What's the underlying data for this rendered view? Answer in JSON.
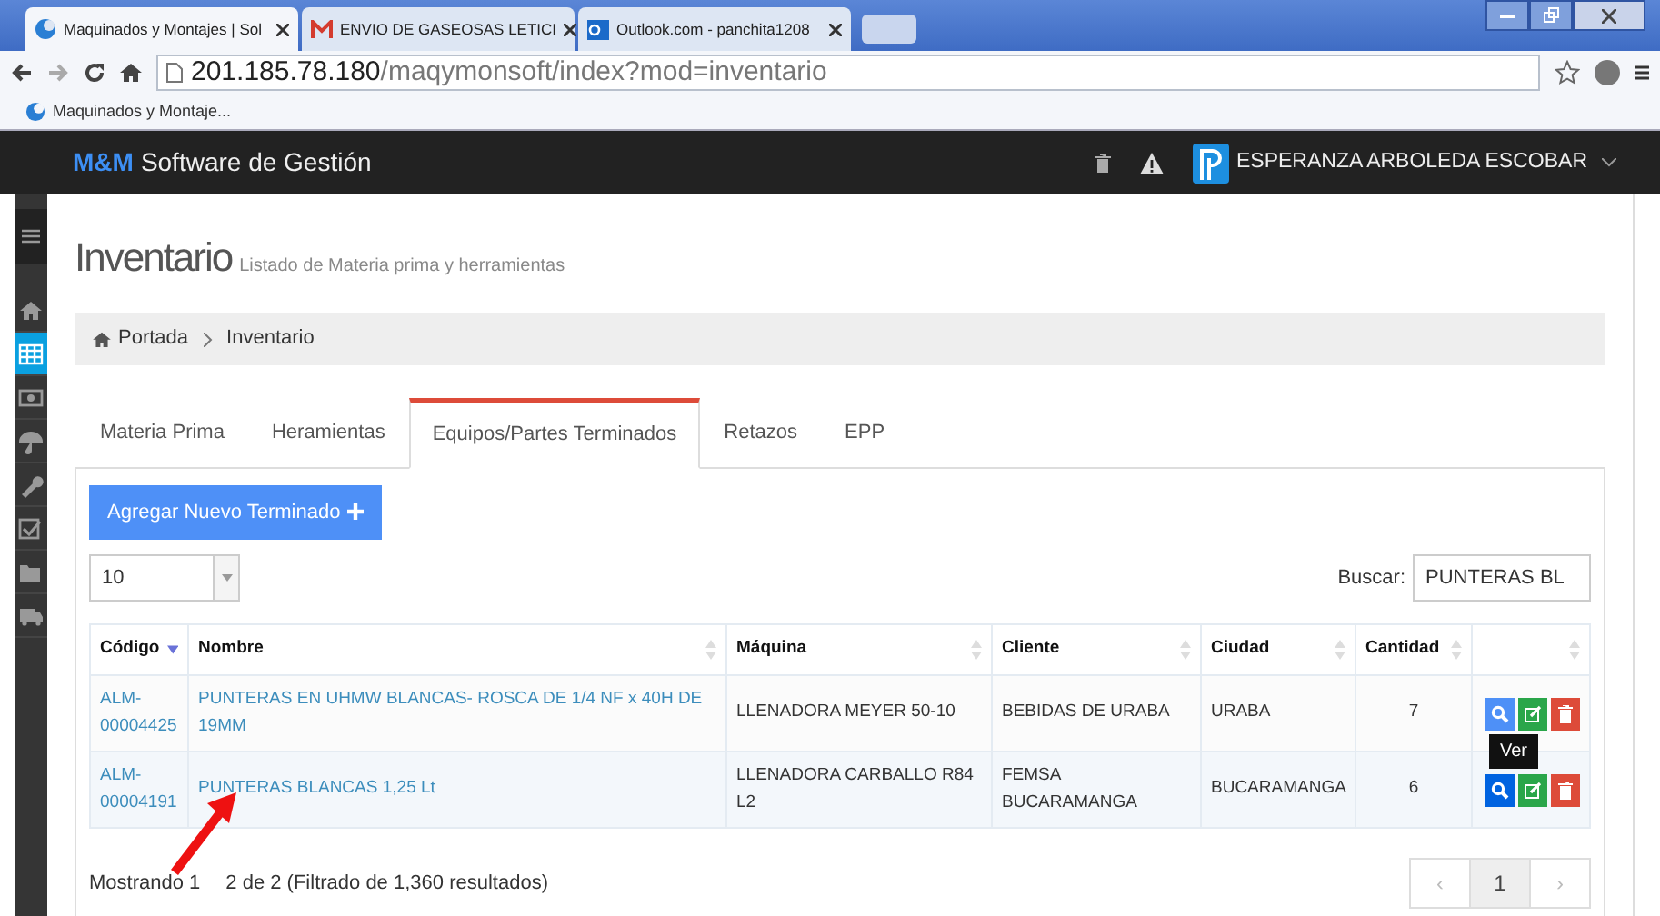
{
  "browser": {
    "tabs": [
      {
        "kind": "app",
        "title": "Maquinados y Montajes | Sol",
        "selected": true
      },
      {
        "kind": "mail",
        "title": "ENVIO DE GASEOSAS LETICI",
        "selected": false
      },
      {
        "kind": "outlook",
        "title": "Outlook.com - panchita1208",
        "selected": false
      }
    ],
    "address": {
      "host": "201.185.78.180",
      "path": "/maqymonsoft/index?mod=inventario"
    },
    "bookmarks": [
      "Maquinados y Montaje..."
    ]
  },
  "navbar": {
    "brand_mark": "M&M",
    "brand_text": "Software de Gestión",
    "user": "ESPERANZA ARBOLEDA ESCOBAR"
  },
  "sidebar": {
    "items": [
      {
        "kind": "home",
        "selected": false
      },
      {
        "kind": "table",
        "selected": true
      },
      {
        "kind": "money",
        "selected": false
      },
      {
        "kind": "umbrella",
        "selected": false
      },
      {
        "kind": "wrench",
        "selected": false
      },
      {
        "kind": "check",
        "selected": false
      },
      {
        "kind": "folder",
        "selected": false
      },
      {
        "kind": "truck",
        "selected": false
      }
    ]
  },
  "page": {
    "title": "Inventario",
    "subtitle": "Listado de Materia prima y herramientas"
  },
  "breadcrumb": [
    "Portada",
    "Inventario"
  ],
  "tabs": [
    {
      "label": "Materia Prima",
      "selected": false
    },
    {
      "label": "Heramientas",
      "selected": false
    },
    {
      "label": "Equipos/Partes Terminados",
      "selected": true
    },
    {
      "label": "Retazos",
      "selected": false
    },
    {
      "label": "EPP",
      "selected": false
    }
  ],
  "add_button": "Agregar Nuevo Terminado",
  "page_length": "10",
  "search": {
    "label": "Buscar:",
    "value": "PUNTERAS BL"
  },
  "table": {
    "columns": [
      {
        "label": "Código",
        "sorted": true
      },
      {
        "label": "Nombre",
        "sorted": false
      },
      {
        "label": "Máquina",
        "sorted": false
      },
      {
        "label": "Cliente",
        "sorted": false
      },
      {
        "label": "Ciudad",
        "sorted": false
      },
      {
        "label": "Cantidad",
        "sorted": false
      },
      {
        "sorted": false
      }
    ],
    "tooltip": "Ver",
    "rows": [
      {
        "cells": [
          "ALM-00004425",
          "PUNTERAS EN UHMW BLANCAS- ROSCA DE 1/4 NF x 40H DE 19MM",
          "LLENADORA MEYER 50-10",
          "BEBIDAS DE URABA",
          "URABA",
          "7"
        ],
        "view_hovered": false
      },
      {
        "cells": [
          "ALM-00004191",
          "PUNTERAS BLANCAS 1,25 Lt",
          "LLENADORA CARBALLO R84 L2",
          "FEMSA BUCARAMANGA",
          "BUCARAMANGA",
          "6"
        ],
        "view_hovered": true
      }
    ]
  },
  "info": [
    "Mostrando 1",
    "2 de 2 (Filtrado de 1,360 resultados)"
  ],
  "pagination": [
    {
      "label": "‹",
      "disabled": true,
      "selected": false
    },
    {
      "label": "1",
      "disabled": false,
      "selected": true
    },
    {
      "label": "›",
      "disabled": true,
      "selected": false
    }
  ]
}
